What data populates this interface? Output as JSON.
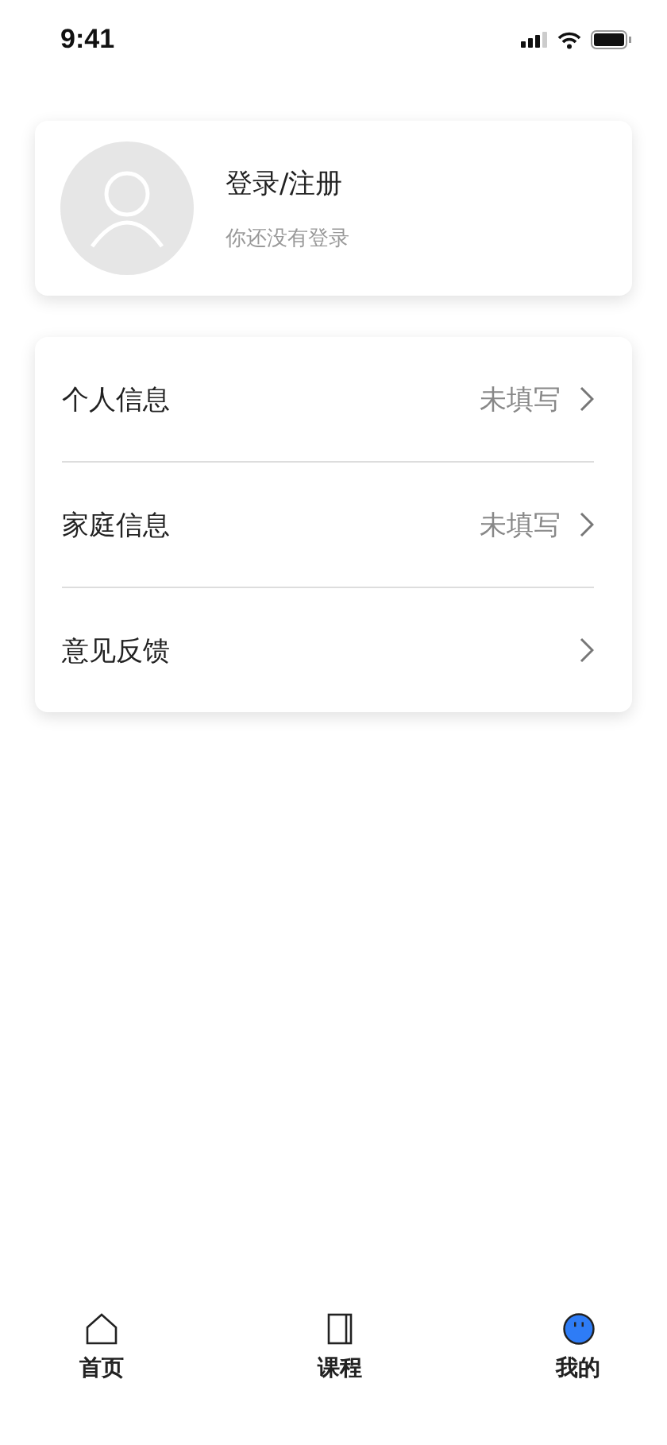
{
  "status_bar": {
    "time": "9:41"
  },
  "profile": {
    "title": "登录/注册",
    "subtitle": "你还没有登录"
  },
  "menu": [
    {
      "label": "个人信息",
      "value": "未填写"
    },
    {
      "label": "家庭信息",
      "value": "未填写"
    },
    {
      "label": "意见反馈"
    }
  ],
  "tabs": [
    {
      "label": "首页",
      "kind": "home",
      "selected": false
    },
    {
      "label": "课程",
      "kind": "book",
      "selected": false
    },
    {
      "label": "我的",
      "kind": "face",
      "selected": true
    }
  ]
}
